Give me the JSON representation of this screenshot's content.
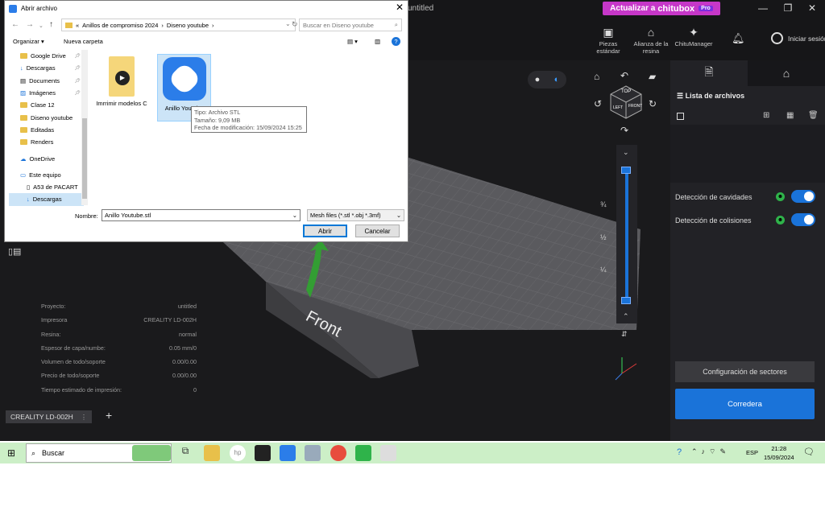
{
  "app": {
    "title": "untitled",
    "upgrade": {
      "label": "Actualizar a",
      "brand": "chitubox",
      "badge": "Pro"
    },
    "toolbar": [
      {
        "label": "Piezas estándar",
        "icon": "parts-icon"
      },
      {
        "label": "Alianza de la resina",
        "icon": "resin-alliance-icon"
      },
      {
        "label": "ChituManager",
        "icon": "chitumanager-icon"
      }
    ],
    "login_label": "Iniciar sesión",
    "view_labels": {
      "front": "Front",
      "cube_top": "TOP",
      "cube_left": "LEFT",
      "cube_front": "FRONT"
    },
    "slider_fracs": [
      "¾",
      "½",
      "¼"
    ],
    "info": [
      {
        "k": "Proyecto:",
        "v": "untitled"
      },
      {
        "k": "Impresora",
        "v": "CREALITY LD-002H"
      },
      {
        "k": "Resina:",
        "v": "normal"
      },
      {
        "k": "Espesor de capa/numbe:",
        "v": "0.05 mm/0"
      },
      {
        "k": "Volumen de todo/soporte",
        "v": "0.00/0.00"
      },
      {
        "k": "Precio de todo/soporte",
        "v": "0.00/0.00"
      },
      {
        "k": "Tiempo estimado de impresión:",
        "v": "0"
      }
    ],
    "printer_tab": "CREALITY LD-002H",
    "right_panel": {
      "file_list_title": "Lista de archivos",
      "cavity_detection": "Detección de cavidades",
      "collision_detection": "Detección de colisiones",
      "sectors_button": "Configuración de sectores",
      "slice_button": "Corredera"
    }
  },
  "dialog": {
    "title": "Abrir archivo",
    "path": [
      "Anillos de compromiso 2024",
      "Diseno youtube"
    ],
    "search_placeholder": "Buscar en Diseno youtube",
    "organize": "Organizar ▾",
    "new_folder": "Nueva carpeta",
    "nav": [
      {
        "label": "Google Drive",
        "pinned": true
      },
      {
        "label": "Descargas",
        "pinned": true
      },
      {
        "label": "Documents",
        "pinned": true
      },
      {
        "label": "Imágenes",
        "pinned": true
      },
      {
        "label": "Clase 12",
        "pinned": false
      },
      {
        "label": "Diseno youtube",
        "pinned": false
      },
      {
        "label": "Editadas",
        "pinned": false
      },
      {
        "label": "Renders",
        "pinned": false
      },
      {
        "label": "OneDrive",
        "pinned": false
      },
      {
        "label": "Este equipo",
        "pinned": false
      },
      {
        "label": "A53 de PACART",
        "pinned": false
      },
      {
        "label": "Descargas",
        "pinned": false
      }
    ],
    "files": [
      {
        "name": "Imrrimir modelos C"
      },
      {
        "name": "Anillo Youtube"
      }
    ],
    "tooltip": [
      "Tipo: Archivo STL",
      "Tamaño: 9,09 MB",
      "Fecha de modificación: 15/09/2024 15:25"
    ],
    "name_label": "Nombre:",
    "name_value": "Anillo Youtube.stl",
    "type_filter": "Mesh files (*.stl *.obj *.3mf)",
    "open_button": "Abrir",
    "cancel_button": "Cancelar"
  },
  "taskbar": {
    "search_label": "Buscar",
    "lang": "ESP",
    "time": "21:28",
    "date": "15/09/2024"
  },
  "colors": {
    "accent": "#1a73d9",
    "upgrade": "#c637c8",
    "taskbar": "#ccefc7"
  }
}
